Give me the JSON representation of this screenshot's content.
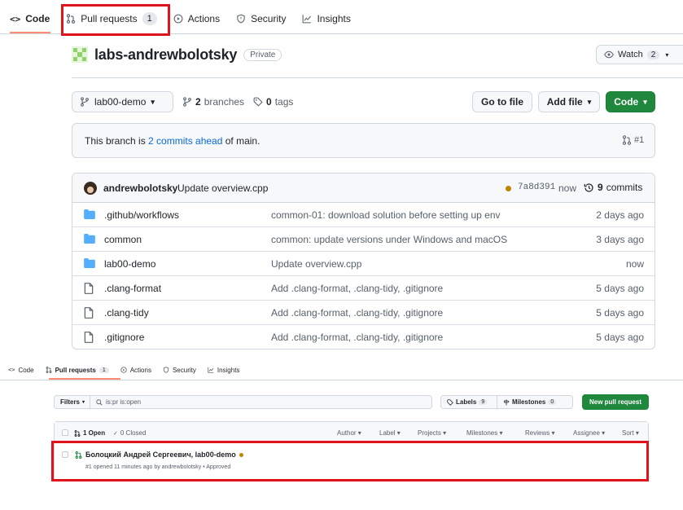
{
  "repo_view": {
    "tabs": [
      {
        "label": "Code",
        "icon": "code-icon"
      },
      {
        "label": "Pull requests",
        "count": "1",
        "icon": "git-pull-request-icon"
      },
      {
        "label": "Actions",
        "icon": "play-icon"
      },
      {
        "label": "Security",
        "icon": "shield-icon"
      },
      {
        "label": "Insights",
        "icon": "graph-icon"
      }
    ],
    "repo_name": "labs-andrewbolotsky",
    "visibility": "Private",
    "watch": {
      "label": "Watch",
      "count": "2"
    },
    "branch": "lab00-demo",
    "branches": {
      "count": "2",
      "label": "branches"
    },
    "tags": {
      "count": "0",
      "label": "tags"
    },
    "buttons": {
      "go_to_file": "Go to file",
      "add_file": "Add file",
      "code": "Code"
    },
    "ahead": {
      "prefix": "This branch is ",
      "link": "2 commits ahead",
      "suffix": " of main.",
      "pr": "#1"
    },
    "latest_commit": {
      "author": "andrewbolotsky",
      "message": "Update overview.cpp",
      "sha": "7a8d391",
      "time": "now",
      "count": "9",
      "count_label": "commits"
    },
    "files": [
      {
        "type": "dir",
        "name": ".github/workflows",
        "message": "common-01: download solution before setting up env",
        "age": "2 days ago"
      },
      {
        "type": "dir",
        "name": "common",
        "message": "common: update versions under Windows and macOS",
        "age": "3 days ago"
      },
      {
        "type": "dir",
        "name": "lab00-demo",
        "message": "Update overview.cpp",
        "age": "now"
      },
      {
        "type": "file",
        "name": ".clang-format",
        "message": "Add .clang-format, .clang-tidy, .gitignore",
        "age": "5 days ago"
      },
      {
        "type": "file",
        "name": ".clang-tidy",
        "message": "Add .clang-format, .clang-tidy, .gitignore",
        "age": "5 days ago"
      },
      {
        "type": "file",
        "name": ".gitignore",
        "message": "Add .clang-format, .clang-tidy, .gitignore",
        "age": "5 days ago"
      }
    ]
  },
  "pr_view": {
    "tabs": [
      {
        "label": "Code",
        "icon": "code-icon"
      },
      {
        "label": "Pull requests",
        "count": "1",
        "icon": "git-pull-request-icon"
      },
      {
        "label": "Actions",
        "icon": "play-icon"
      },
      {
        "label": "Security",
        "icon": "shield-icon"
      },
      {
        "label": "Insights",
        "icon": "graph-icon"
      }
    ],
    "filters_label": "Filters",
    "search_value": "is:pr is:open",
    "labels": {
      "label": "Labels",
      "count": "9"
    },
    "milestones": {
      "label": "Milestones",
      "count": "0"
    },
    "new_pr": "New pull request",
    "open_label": "1 Open",
    "closed_label": "0 Closed",
    "filter_menus": [
      "Author",
      "Label",
      "Projects",
      "Milestones",
      "Reviews",
      "Assignee",
      "Sort"
    ],
    "pull_request": {
      "title": "Болоцкий Андрей Сергеевич, lab00-demo",
      "meta": "#1 opened 11 minutes ago by andrewbolotsky • Approved"
    }
  },
  "colors": {
    "highlight_box": "#e0131a",
    "primary_button": "#1f883d",
    "link": "#0969da",
    "pending_status": "#bf8700",
    "tab_underline": "#fd8c73"
  }
}
